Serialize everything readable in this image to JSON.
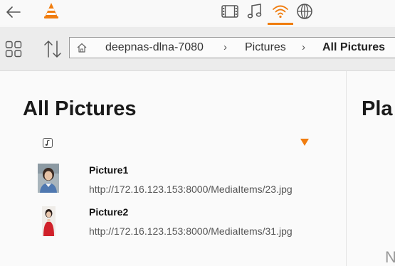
{
  "colors": {
    "accent": "#f07d0f"
  },
  "topbar": {
    "icons": [
      "back-arrow-icon",
      "vlc-cone-logo",
      "video-icon",
      "music-icon",
      "network-icon",
      "globe-icon"
    ],
    "active_tab": "network-icon"
  },
  "toolbar": {
    "icons": [
      "grid-icon",
      "sort-icon",
      "home-icon"
    ],
    "breadcrumb": [
      "deepnas-dlna-7080",
      "Pictures",
      "All Pictures"
    ]
  },
  "main": {
    "title": "All Pictures",
    "items": [
      {
        "title": "Picture1",
        "url": "http://172.16.123.153:8000/MediaItems/23.jpg"
      },
      {
        "title": "Picture2",
        "url": "http://172.16.123.153:8000/MediaItems/31.jpg"
      }
    ]
  },
  "side": {
    "title": "Pla",
    "letter": "N"
  }
}
